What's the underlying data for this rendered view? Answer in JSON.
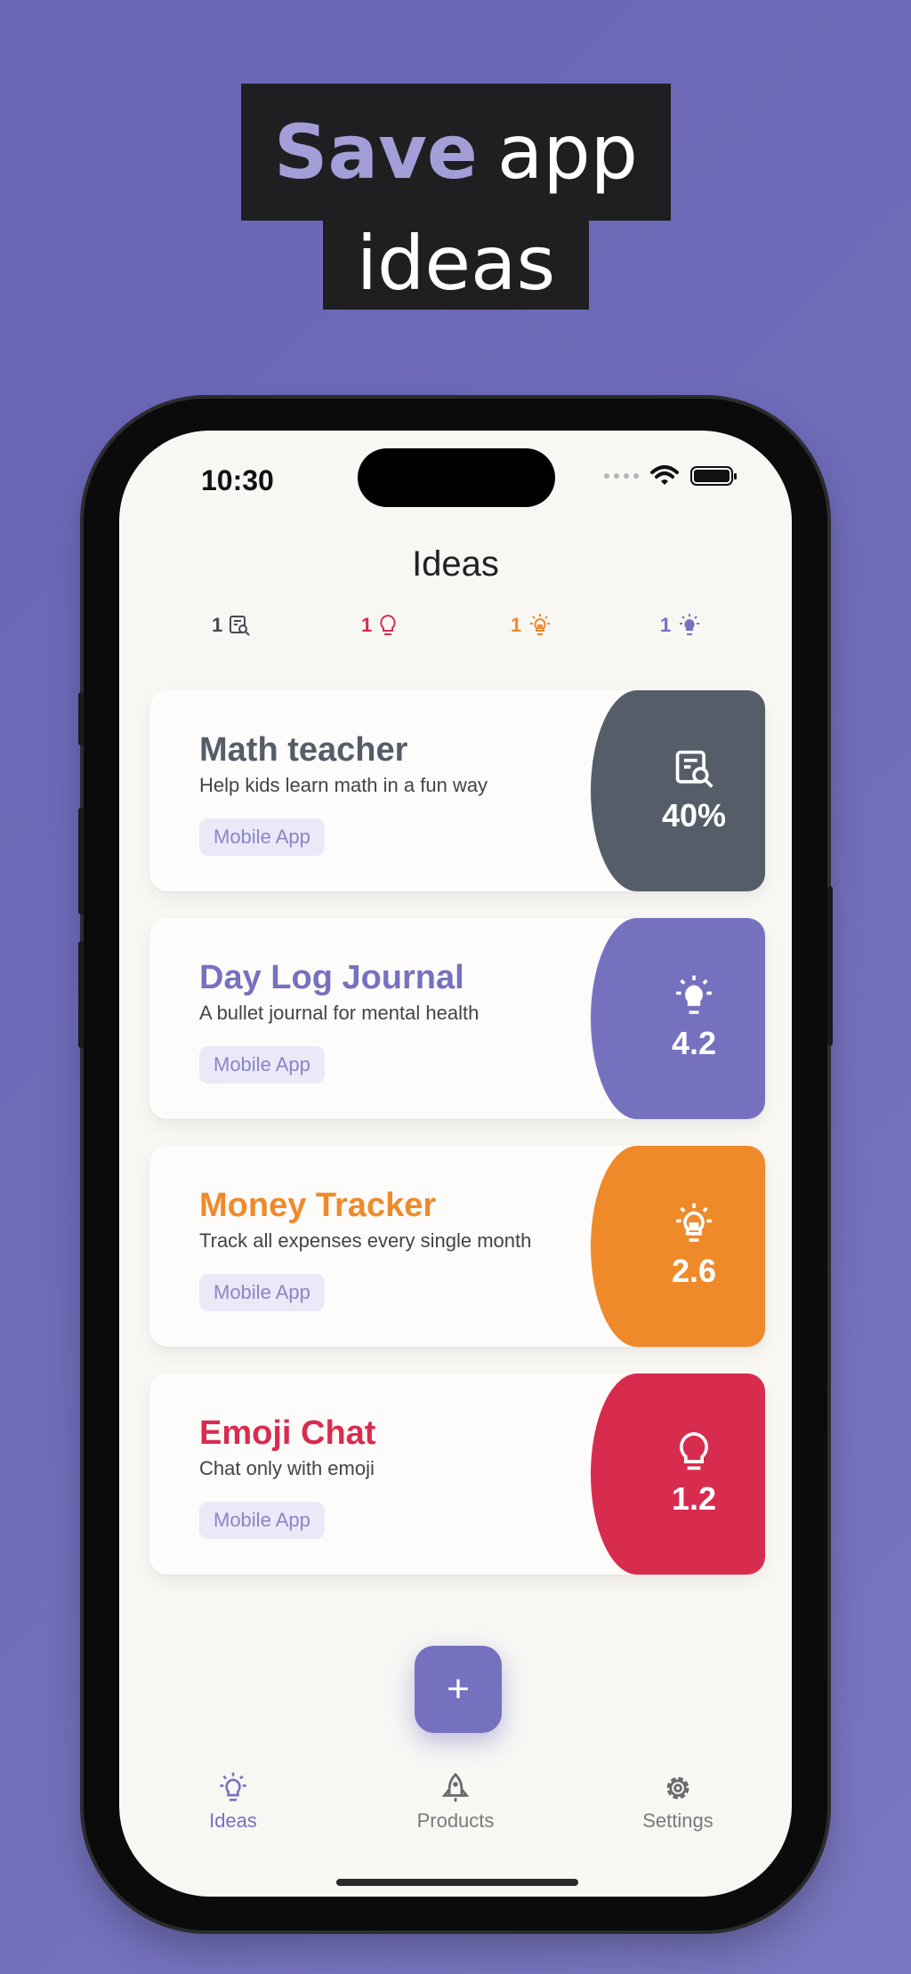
{
  "headline": {
    "strong": "Save",
    "rest": "app",
    "line2": "ideas"
  },
  "status": {
    "time": "10:30"
  },
  "screen": {
    "title": "Ideas"
  },
  "stats": [
    {
      "count": "1",
      "icon": "research-icon",
      "color": "#454a55"
    },
    {
      "count": "1",
      "icon": "bulb-outline-icon",
      "color": "#d82c4f"
    },
    {
      "count": "1",
      "icon": "bulb-glow-icon",
      "color": "#ef8a2b"
    },
    {
      "count": "1",
      "icon": "bulb-solid-icon",
      "color": "#7671bf"
    }
  ],
  "ideas": [
    {
      "title": "Math teacher",
      "description": "Help kids learn math in a fun way",
      "tag": "Mobile App",
      "score": "40%",
      "color": "#555d68",
      "icon": "research-icon"
    },
    {
      "title": "Day Log Journal",
      "description": "A bullet journal for mental health",
      "tag": "Mobile App",
      "score": "4.2",
      "color": "#7671bf",
      "icon": "bulb-solid-icon"
    },
    {
      "title": "Money Tracker",
      "description": "Track all expenses every single month",
      "tag": "Mobile App",
      "score": "2.6",
      "color": "#ef8a2b",
      "icon": "bulb-glow-icon"
    },
    {
      "title": "Emoji Chat",
      "description": "Chat only with emoji",
      "tag": "Mobile App",
      "score": "1.2",
      "color": "#d82c4f",
      "icon": "bulb-outline-icon"
    }
  ],
  "fab": {
    "label": "+"
  },
  "tabs": [
    {
      "label": "Ideas",
      "icon": "lightbulb-icon",
      "active": true
    },
    {
      "label": "Products",
      "icon": "rocket-icon",
      "active": false
    },
    {
      "label": "Settings",
      "icon": "gear-icon",
      "active": false
    }
  ],
  "colors": {
    "background": "#6f6cb9",
    "accent": "#7671bf",
    "inactive_tab": "#7a7a7a",
    "headline_strong": "#a39ed8"
  }
}
